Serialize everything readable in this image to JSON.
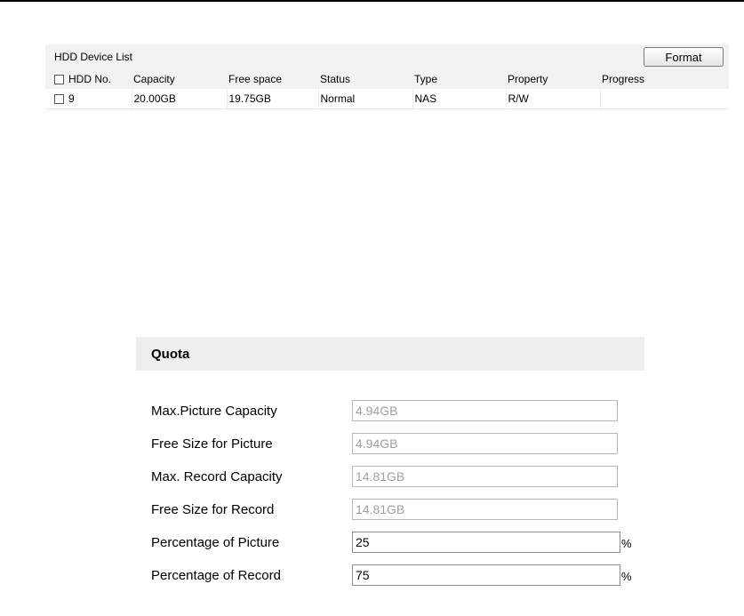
{
  "hdd": {
    "title": "HDD Device List",
    "format_label": "Format",
    "columns": [
      "HDD No.",
      "Capacity",
      "Free space",
      "Status",
      "Type",
      "Property",
      "Progress"
    ],
    "rows": [
      {
        "no": "9",
        "capacity": "20.00GB",
        "free": "19.75GB",
        "status": "Normal",
        "type": "NAS",
        "property": "R/W",
        "progress": ""
      }
    ]
  },
  "quota": {
    "title": "Quota",
    "fields": [
      {
        "label": "Max.Picture Capacity",
        "value": "4.94GB",
        "editable": false
      },
      {
        "label": "Free Size for Picture",
        "value": "4.94GB",
        "editable": false
      },
      {
        "label": "Max. Record Capacity",
        "value": "14.81GB",
        "editable": false
      },
      {
        "label": "Free Size for Record",
        "value": "14.81GB",
        "editable": false
      },
      {
        "label": "Percentage of Picture",
        "value": "25",
        "editable": true,
        "unit": "%"
      },
      {
        "label": "Percentage of Record",
        "value": "75",
        "editable": true,
        "unit": "%"
      }
    ]
  }
}
